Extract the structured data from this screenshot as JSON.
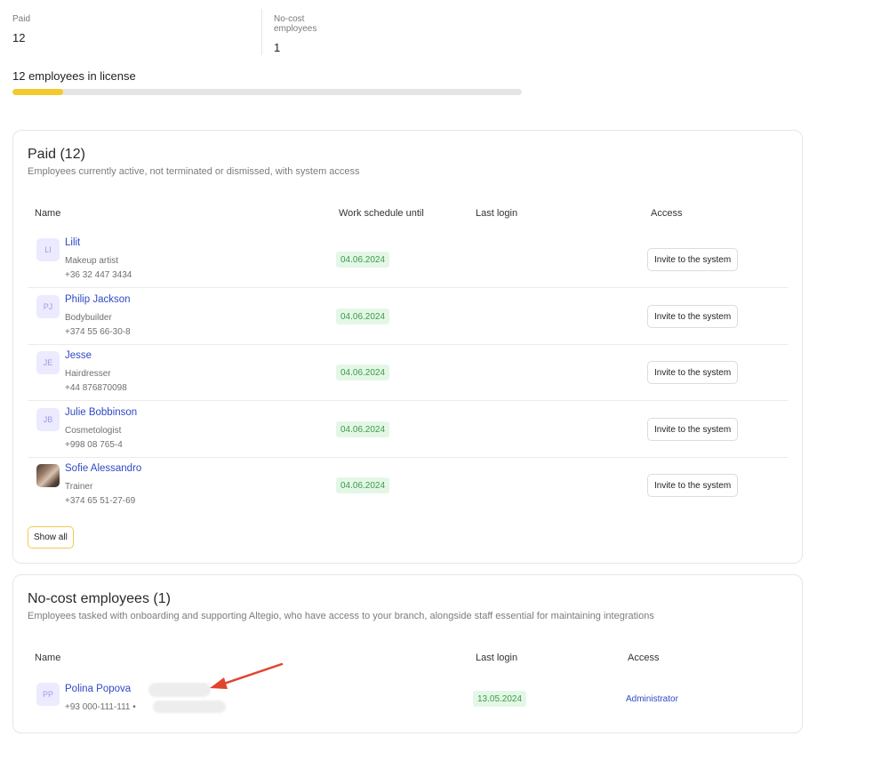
{
  "stats": {
    "paid_label": "Paid",
    "paid_value": "12",
    "nocost_label": "No-cost employees",
    "nocost_value": "1"
  },
  "license": {
    "title": "12 employees in license",
    "progress_fraction": 0.1,
    "progress_color": "#f4c92f"
  },
  "paid_section": {
    "title": "Paid (12)",
    "description": "Employees currently active, not terminated or dismissed, with system access",
    "columns": {
      "name": "Name",
      "schedule": "Work schedule until",
      "last_login": "Last login",
      "access": "Access"
    },
    "rows": [
      {
        "initials": "LI",
        "name": "Lilit",
        "role": "Makeup artist",
        "phone": "+36 32 447 3434",
        "schedule": "04.06.2024",
        "access_button": "Invite to the system"
      },
      {
        "initials": "PJ",
        "name": "Philip Jackson",
        "role": "Bodybuilder",
        "phone": "+374 55 66-30-8",
        "schedule": "04.06.2024",
        "access_button": "Invite to the system"
      },
      {
        "initials": "JE",
        "name": "Jesse",
        "role": "Hairdresser",
        "phone": "+44 876870098",
        "schedule": "04.06.2024",
        "access_button": "Invite to the system"
      },
      {
        "initials": "JB",
        "name": "Julie Bobbinson",
        "role": "Cosmetologist",
        "phone": "+998 08 765-4",
        "schedule": "04.06.2024",
        "access_button": "Invite to the system"
      },
      {
        "initials": "",
        "name": "Sofie Alessandro",
        "role": "Trainer",
        "phone": "+374 65 51-27-69",
        "schedule": "04.06.2024",
        "access_button": "Invite to the system"
      }
    ],
    "show_all": "Show all"
  },
  "nocost_section": {
    "title": "No-cost employees (1)",
    "description": "Employees tasked with onboarding and supporting Altegio, who have access to your branch, alongside staff essential for maintaining integrations",
    "columns": {
      "name": "Name",
      "last_login": "Last login",
      "access": "Access"
    },
    "row": {
      "initials": "PP",
      "name": "Polina Popova",
      "phone": "+93 000-111-111 •",
      "last_login": "13.05.2024",
      "access": "Administrator"
    }
  },
  "colors": {
    "link": "#2f49c6",
    "date_badge_bg": "#e4f7e6",
    "date_badge_text": "#3a9b4a",
    "avatar_bg": "#eceaff",
    "arrow": "#e0442f"
  }
}
